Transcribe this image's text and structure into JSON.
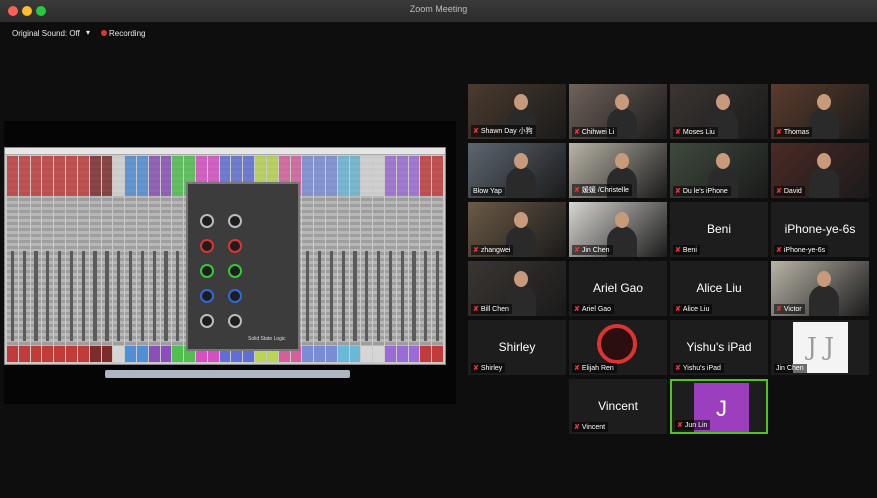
{
  "window": {
    "title": "Zoom Meeting"
  },
  "topbar": {
    "original_sound": "Original Sound: Off",
    "recording": "Recording"
  },
  "share": {
    "plugin_label": "Solid State Logic"
  },
  "participants": [
    {
      "name": "Shawn Day 小狗",
      "type": "video",
      "muted": true
    },
    {
      "name": "Chihwei Li",
      "type": "video",
      "muted": true
    },
    {
      "name": "Moses Liu",
      "type": "video",
      "muted": true
    },
    {
      "name": "Thomas",
      "type": "video",
      "muted": true
    },
    {
      "name": "Blow Yap",
      "type": "video",
      "muted": false
    },
    {
      "name": "媛媛 /Christelle",
      "type": "video",
      "muted": true
    },
    {
      "name": "Du le's iPhone",
      "type": "video",
      "muted": true
    },
    {
      "name": "David",
      "type": "video",
      "muted": true
    },
    {
      "name": "zhangwei",
      "type": "video",
      "muted": true
    },
    {
      "name": "Jin Chen",
      "type": "video",
      "muted": true
    },
    {
      "name": "Beni",
      "type": "name",
      "display": "Beni",
      "muted": true
    },
    {
      "name": "iPhone-ye-6s",
      "type": "name",
      "display": "iPhone-ye-6s",
      "muted": true
    },
    {
      "name": "Bill Chen",
      "type": "video",
      "muted": true
    },
    {
      "name": "Ariel Gao",
      "type": "name",
      "display": "Ariel Gao",
      "muted": true
    },
    {
      "name": "Alice Liu",
      "type": "name",
      "display": "Alice Liu",
      "muted": true
    },
    {
      "name": "Victor",
      "type": "video",
      "muted": true
    },
    {
      "name": "Shirley",
      "type": "name",
      "display": "Shirley",
      "muted": true
    },
    {
      "name": "Elijah Ren",
      "type": "image",
      "muted": true
    },
    {
      "name": "Yishu's iPad",
      "type": "name",
      "display": "Yishu's iPad",
      "muted": true
    },
    {
      "name": "Jin Chen",
      "type": "image",
      "muted": false
    },
    {
      "name": "Vincent",
      "type": "name",
      "display": "Vincent",
      "muted": true
    },
    {
      "name": "Jun Lin",
      "type": "avatar",
      "initial": "J",
      "muted": true,
      "active": true
    }
  ],
  "colors": {
    "accent_active": "#52c41a",
    "recording": "#e0343a"
  }
}
